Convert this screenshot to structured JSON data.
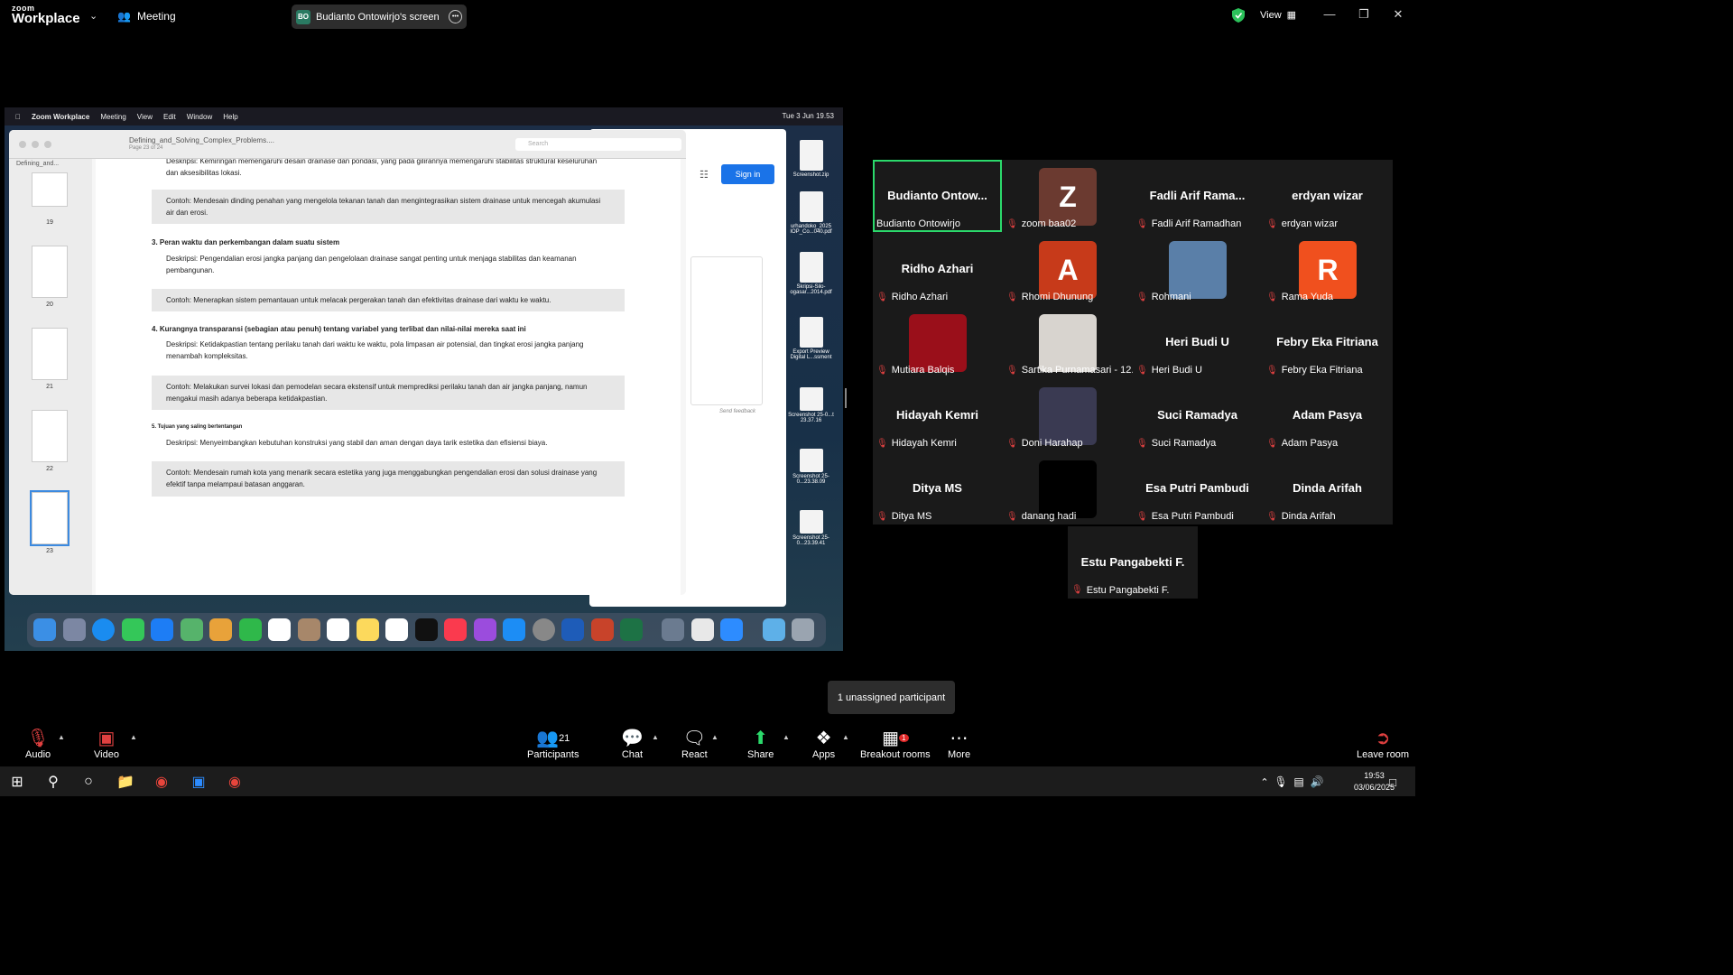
{
  "app": {
    "logo_small": "zoom",
    "logo_big": "Workplace",
    "meeting_label": "Meeting",
    "share_initials": "BO",
    "share_label": "Budianto Ontowirjo's screen",
    "view_label": "View"
  },
  "mac": {
    "menubar": [
      "Zoom Workplace",
      "Meeting",
      "View",
      "Edit",
      "Window",
      "Help"
    ],
    "clock": "Tue 3 Jun  19.53",
    "preview": {
      "title": "Defining_and_Solving_Complex_Problems....",
      "pages": "Page 23 of 24",
      "search_placeholder": "Search",
      "sidebar_name": "Defining_and...",
      "thumbs": [
        "19",
        "20",
        "21",
        "22",
        "23"
      ]
    },
    "browser": {
      "signin": "Sign in",
      "feedback": "Send feedback"
    },
    "doc": {
      "l1": "Deskripsi: Kemiringan memengaruhi desain drainase dan pondasi, yang pada gilirannya memengaruhi stabilitas struktural keseluruhan",
      "l2": "dan aksesibilitas lokasi.",
      "b1": "Contoh: Mendesain dinding penahan yang mengelola tekanan tanah dan mengintegrasikan sistem drainase untuk mencegah akumulasi air dan erosi.",
      "h3": "3. Peran waktu dan perkembangan dalam suatu sistem",
      "d3": "Deskripsi: Pengendalian erosi jangka panjang dan pengelolaan drainase sangat penting untuk menjaga stabilitas dan keamanan pembangunan.",
      "b3": "Contoh: Menerapkan sistem pemantauan untuk melacak pergerakan tanah dan efektivitas drainase dari waktu ke waktu.",
      "h4": "4. Kurangnya transparansi (sebagian atau penuh) tentang variabel yang terlibat dan nilai-nilai mereka saat ini",
      "d4": "Deskripsi: Ketidakpastian tentang perilaku tanah dari waktu ke waktu, pola limpasan air potensial, dan tingkat erosi jangka panjang menambah kompleksitas.",
      "b4": "Contoh: Melakukan survei lokasi dan pemodelan secara ekstensif untuk memprediksi perilaku tanah dan air jangka panjang, namun mengakui masih adanya beberapa ketidakpastian.",
      "h5": "5. Tujuan yang saling bertentangan",
      "d5": "Deskripsi: Menyeimbangkan kebutuhan konstruksi yang stabil dan aman dengan daya tarik estetika dan efisiensi biaya.",
      "b5": "Contoh: Mendesain rumah kota yang menarik secara estetika yang juga menggabungkan pengendalian erosi dan solusi drainase yang efektif tanpa melampaui batasan anggaran."
    },
    "desktop": [
      "Screenshot.zip",
      "urhandoko_2025 IOP_Co...040.pdf",
      "Skripsi-Silo-ogasar...2014.pdf",
      "Export Preview Digital L...ssment",
      "Screenshot 25-0...t 23.37.16",
      "Screenshot 25-0...23.38.09",
      "Screenshot 25-0...23.39.41"
    ]
  },
  "participants": [
    {
      "big": "Budianto  Ontow...",
      "name": "Budianto Ontowirjo",
      "muted": false
    },
    {
      "avatar": "Z",
      "color": "#6b3a30",
      "name": "zoom baa02",
      "muted": true
    },
    {
      "big": "Fadli Arif Rama...",
      "name": "Fadli Arif Ramadhan",
      "muted": true
    },
    {
      "big": "erdyan wizar",
      "name": "erdyan wizar",
      "muted": true
    },
    {
      "big": "Ridho Azhari",
      "name": "Ridho Azhari",
      "muted": true
    },
    {
      "avatar": "A",
      "color": "#c73a1a",
      "name": "Rhomi Dhunung",
      "muted": true
    },
    {
      "avatar": "",
      "color": "#5a7fa8",
      "name": "Rohmani",
      "muted": true
    },
    {
      "avatar": "R",
      "color": "#f0501e",
      "name": "Rama Yuda",
      "muted": true
    },
    {
      "avatar": "",
      "color": "#9a0f1a",
      "name": "Mutiara Balqis",
      "muted": true
    },
    {
      "avatar": "",
      "color": "#d8d4cf",
      "name": "Sartika Purnamasari - 12...",
      "muted": true
    },
    {
      "big": "Heri Budi U",
      "name": "Heri Budi U",
      "muted": true
    },
    {
      "big": "Febry Eka Fitriana",
      "name": "Febry Eka Fitriana",
      "muted": true
    },
    {
      "big": "Hidayah Kemri",
      "name": "Hidayah Kemri",
      "muted": true
    },
    {
      "avatar": "",
      "color": "#3a3a52",
      "name": "Doni Harahap",
      "muted": true
    },
    {
      "big": "Suci Ramadya",
      "name": "Suci Ramadya",
      "muted": true
    },
    {
      "big": "Adam Pasya",
      "name": "Adam Pasya",
      "muted": true
    },
    {
      "big": "Ditya MS",
      "name": "Ditya MS",
      "muted": true
    },
    {
      "avatar": "",
      "color": "#000000",
      "name": "danang hadi",
      "muted": true
    },
    {
      "big": "Esa Putri Pambudi",
      "name": "Esa Putri Pambudi",
      "muted": true
    },
    {
      "big": "Dinda Arifah",
      "name": "Dinda Arifah",
      "muted": true
    }
  ],
  "extra_participant": {
    "big": "Estu Pangabekti F.",
    "name": "Estu Pangabekti F."
  },
  "tooltip": "1 unassigned participant",
  "toolbar": {
    "audio": "Audio",
    "video": "Video",
    "participants": "Participants",
    "participants_count": "21",
    "chat": "Chat",
    "react": "React",
    "share": "Share",
    "apps": "Apps",
    "breakout": "Breakout rooms",
    "breakout_badge": "1",
    "more": "More",
    "leave": "Leave room"
  },
  "taskbar": {
    "time": "19:53",
    "date": "03/06/2025"
  }
}
